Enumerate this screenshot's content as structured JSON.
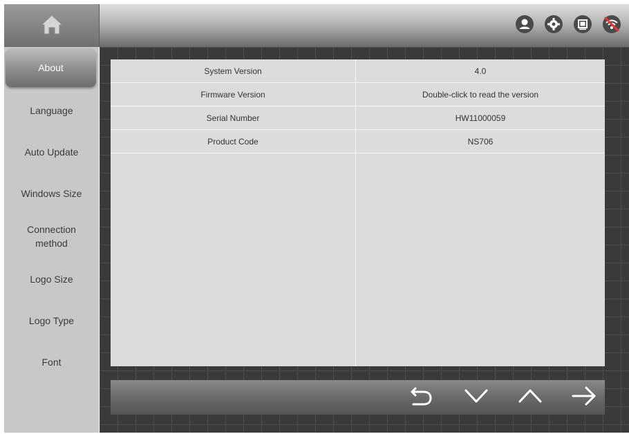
{
  "top_icons": [
    "user-icon",
    "gear-icon",
    "screen-icon",
    "wifi-off-icon"
  ],
  "home_icon": "home-icon",
  "sidebar": {
    "items": [
      {
        "label": "About",
        "active": true
      },
      {
        "label": "Language"
      },
      {
        "label": "Auto Update"
      },
      {
        "label": "Windows Size"
      },
      {
        "label": "Connection\nmethod"
      },
      {
        "label": "Logo Size"
      },
      {
        "label": "Logo Type"
      },
      {
        "label": "Font"
      }
    ]
  },
  "info_table": {
    "rows": [
      {
        "label": "System Version",
        "value": "4.0"
      },
      {
        "label": "Firmware Version",
        "value": "Double-click to read the version"
      },
      {
        "label": "Serial Number",
        "value": "HW11000059"
      },
      {
        "label": "Product Code",
        "value": "NS706"
      }
    ]
  },
  "bottom_nav": [
    "back-icon",
    "down-icon",
    "up-icon",
    "next-icon"
  ],
  "colors": {
    "panel": "#dcdcdc",
    "grid_bg": "#3a3a3a",
    "sidebar": "#c8c8c8",
    "active_item": "#8c8c8c"
  }
}
